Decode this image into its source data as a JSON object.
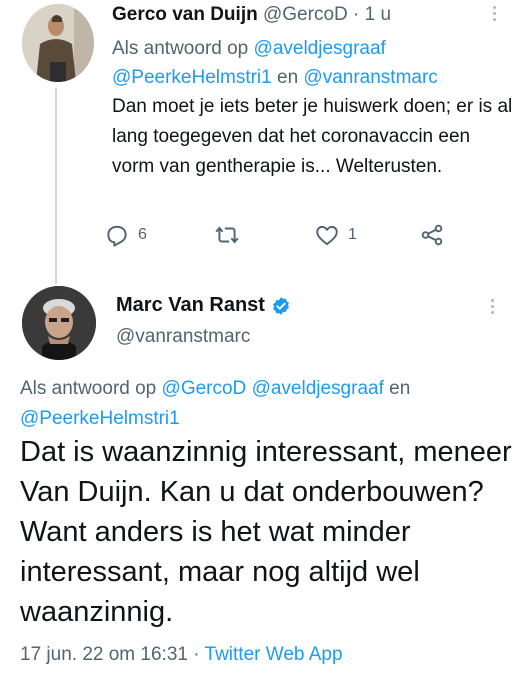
{
  "reply_tweet": {
    "display_name": "Gerco van Duijn",
    "handle": "@GercoD",
    "separator": " · ",
    "time_ago": "1 u",
    "replying_prefix": "Als antwoord op ",
    "replying_to": [
      "@aveldjesgraaf",
      "@PeerkeHelmstri1",
      "@vanranstmarc"
    ],
    "replying_joiner": " en ",
    "text": "Dan moet je iets beter je huiswerk doen; er is al lang toegegeven dat het coronavaccin een vorm van gentherapie is... Welterusten.",
    "actions": {
      "reply_count": "6",
      "retweet_count": "",
      "like_count": "1"
    }
  },
  "main_tweet": {
    "display_name": "Marc Van Ranst",
    "handle": "@vanranstmarc",
    "replying_prefix": "Als antwoord op ",
    "replying_to": [
      "@GercoD",
      "@aveldjesgraaf",
      "@PeerkeHelmstri1"
    ],
    "replying_joiner": " en ",
    "text": "Dat is waanzinnig interessant, meneer Van Duijn. Kan u dat onderbouwen? Want anders is het wat minder interessant, maar nog altijd wel waanzinnig.",
    "timestamp": "17 jun. 22 om 16:31",
    "meta_separator": " · ",
    "source": "Twitter Web App"
  },
  "colors": {
    "link": "#1d9bf0",
    "muted": "#536471",
    "text": "#0f1419",
    "thread_line": "#cfd9de",
    "verified": "#1d9bf0"
  },
  "icons": {
    "reply": "reply-icon",
    "retweet": "retweet-icon",
    "like": "heart-icon",
    "share": "share-icon",
    "more": "more-options-icon",
    "verified": "verified-badge-icon"
  }
}
